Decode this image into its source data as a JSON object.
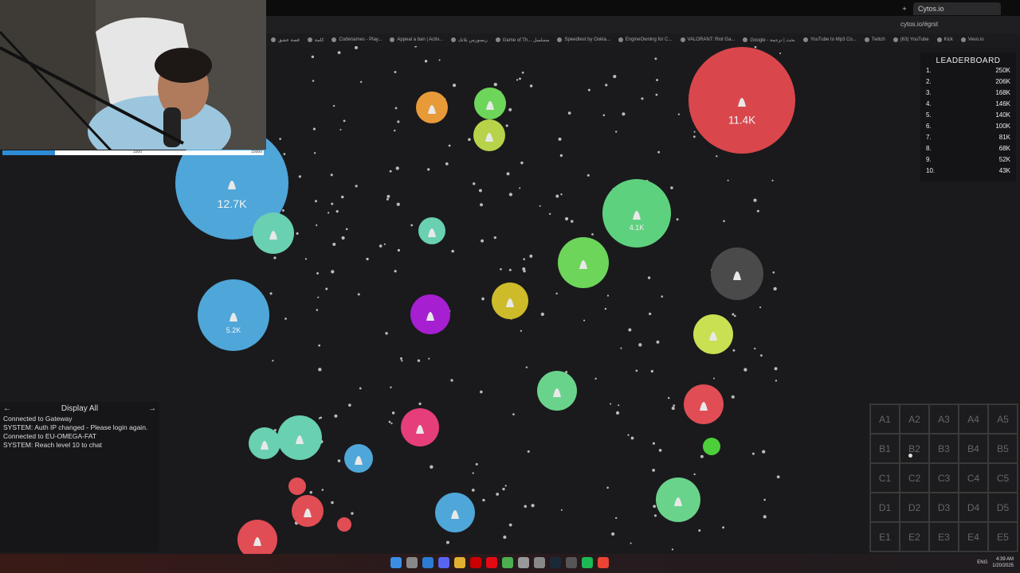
{
  "browser": {
    "tab_title": "Cytos.io",
    "url": "cytos.io/#grst",
    "bookmarks": [
      "قصة عشق",
      "كلمة",
      "Codenames - Play...",
      "Appeal a ban | Activ...",
      "ريسورس بلاتك",
      "Game of Th... مسلسل",
      "Speedtest by Ookla...",
      "EngineOwning for C...",
      "VALORANT: Riot Ga...",
      "Google - بحث | ترجمة",
      "YouTube to Mp3 Co...",
      "Twitch",
      "(63) YouTube",
      "Kick",
      "Vevo.io"
    ]
  },
  "progress": {
    "current": "3300",
    "max": "15000",
    "fraction": 0.2
  },
  "leaderboard": {
    "title": "LEADERBOARD",
    "rows": [
      {
        "rank": "1.",
        "score": "250K"
      },
      {
        "rank": "2.",
        "score": "206K"
      },
      {
        "rank": "3.",
        "score": "168K"
      },
      {
        "rank": "4.",
        "score": "146K"
      },
      {
        "rank": "5.",
        "score": "140K"
      },
      {
        "rank": "6.",
        "score": "100K"
      },
      {
        "rank": "7.",
        "score": "81K"
      },
      {
        "rank": "8.",
        "score": "68K"
      },
      {
        "rank": "9.",
        "score": "52K"
      },
      {
        "rank": "10.",
        "score": "43K"
      }
    ]
  },
  "chat": {
    "header": "Display All",
    "lines": [
      "Connected to Gateway",
      "SYSTEM: Auth IP changed - Please login again.",
      "Connected to EU-OMEGA-FAT",
      "SYSTEM: Reach level 10 to chat"
    ]
  },
  "cells": [
    {
      "color": "#4fa6d9",
      "label": "12.7K"
    },
    {
      "color": "#d9474c",
      "label": "11.4K"
    },
    {
      "color": "#4fa6d9",
      "label": "5.2K"
    },
    {
      "color": "#5ed17f",
      "label": "4.1K"
    }
  ],
  "minimap": {
    "cells": [
      "A1",
      "A2",
      "A3",
      "A4",
      "A5",
      "B1",
      "B2",
      "B3",
      "B4",
      "B5",
      "C1",
      "C2",
      "C3",
      "C4",
      "C5",
      "D1",
      "D2",
      "D3",
      "D4",
      "D5",
      "E1",
      "E2",
      "E3",
      "E4",
      "E5"
    ]
  },
  "taskbar": {
    "lang": "ENG",
    "time": "4:39 AM",
    "date": "1/20/2025"
  }
}
